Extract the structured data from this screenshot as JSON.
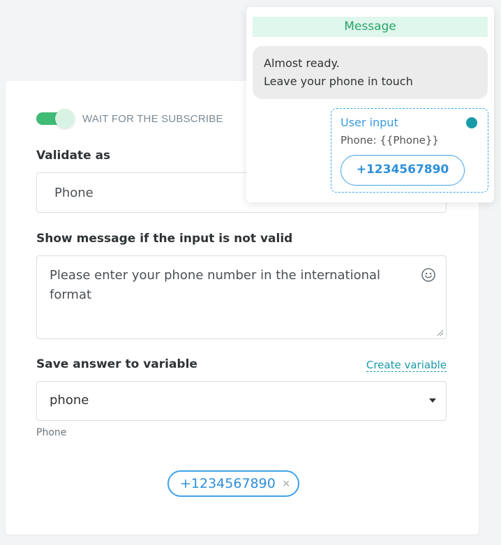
{
  "settings": {
    "wait_toggle_label": "WAIT FOR THE SUBSCRIBE",
    "validate_title": "Validate as",
    "validate_value": "Phone",
    "message_title": "Show message if the input is not valid",
    "message_value": "Please enter your phone number in the international format",
    "save_title": "Save answer to variable",
    "create_variable_label": "Create variable",
    "variable_value": "phone",
    "variable_hint": "Phone",
    "chip_value": "+1234567890",
    "chip_remove": "×"
  },
  "preview": {
    "header": "Message",
    "bubble_line1": "Almost ready.",
    "bubble_line2": "Leave your phone in touch",
    "user_input_label": "User input",
    "phone_variable": "Phone: {{Phone}}",
    "quick_reply": "+1234567890"
  },
  "colors": {
    "toggle_on": "#3fbb76",
    "accent_blue": "#3da3e8",
    "link_teal": "#1b9aa9",
    "header_green_bg": "#dff7ec"
  },
  "icons": {
    "emoji": "smiley-icon",
    "dropdown": "chevron-down-icon",
    "remove": "close-icon"
  }
}
